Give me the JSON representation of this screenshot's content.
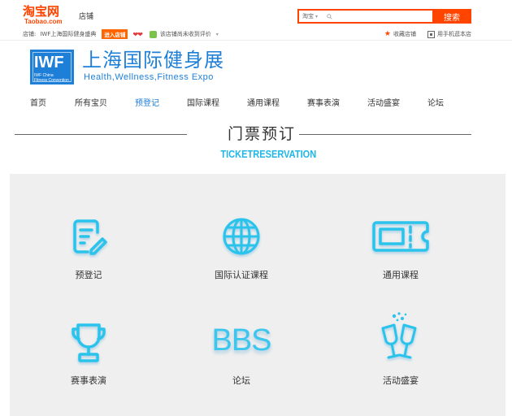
{
  "taobao": {
    "logo_cn": "淘宝网",
    "logo_en": "Taobao.com",
    "shop_label": "店铺",
    "search_scope": "淘宝",
    "search_placeholder": "",
    "search_button": "搜索",
    "shop_prefix": "店铺:",
    "shop_name": "IWF上海国际健身盛典",
    "enter_shop": "进入店铺",
    "hearts": "❤❤",
    "no_eval": "该店铺尚未收到评价",
    "favorite": "收藏店铺",
    "mobile": "用手机逛本店",
    "colors": {
      "accent": "#ff4400"
    }
  },
  "brand": {
    "logo_text": "IWF",
    "logo_sub": "IWF China\nFitness Convention",
    "title_cn": "上海国际健身展",
    "title_en": "Health,Wellness,Fitness Expo",
    "color": "#1e7fd8"
  },
  "nav": {
    "items": [
      {
        "label": "首页",
        "active": false
      },
      {
        "label": "所有宝贝",
        "active": false
      },
      {
        "label": "预登记",
        "active": true
      },
      {
        "label": "国际课程",
        "active": false
      },
      {
        "label": "通用课程",
        "active": false
      },
      {
        "label": "赛事表演",
        "active": false
      },
      {
        "label": "活动盛宴",
        "active": false
      },
      {
        "label": "论坛",
        "active": false
      }
    ]
  },
  "ticket": {
    "title_cn": "门票预订",
    "title_en": "TICKETRESERVATION",
    "accent": "#20b6e8"
  },
  "grid": {
    "items": [
      {
        "label": "预登记",
        "icon": "form-edit-icon"
      },
      {
        "label": "国际认证课程",
        "icon": "globe-icon"
      },
      {
        "label": "通用课程",
        "icon": "ticket-icon"
      },
      {
        "label": "赛事表演",
        "icon": "trophy-icon"
      },
      {
        "label": "论坛",
        "icon": "bbs-icon",
        "icon_text": "BBS"
      },
      {
        "label": "活动盛宴",
        "icon": "champagne-icon"
      }
    ]
  }
}
